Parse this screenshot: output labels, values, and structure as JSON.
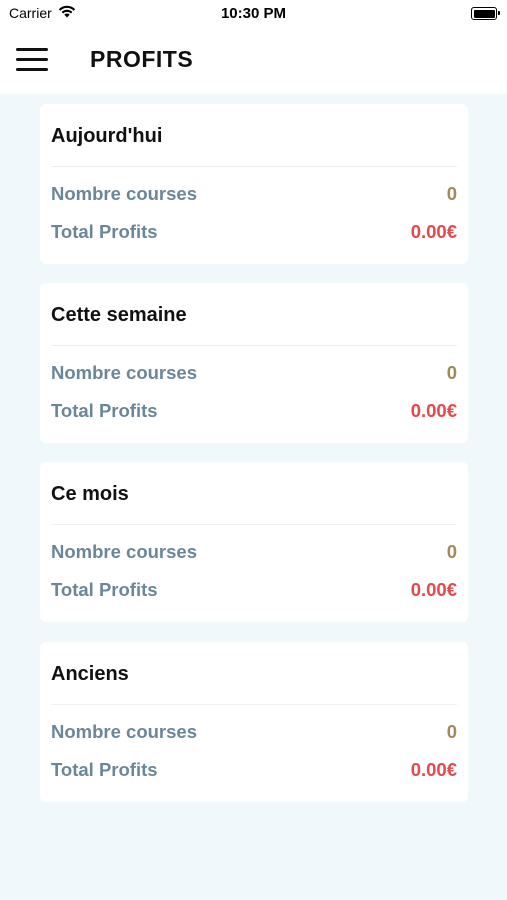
{
  "status_bar": {
    "carrier": "Carrier",
    "time": "10:30 PM",
    "icons": [
      "wifi-icon",
      "battery-icon"
    ]
  },
  "header": {
    "title": "PROFITS",
    "menu_icon": "hamburger-menu-icon"
  },
  "cards": [
    {
      "title": "Aujourd'hui",
      "courses_label": "Nombre courses",
      "courses_value": "0",
      "profits_label": "Total Profits",
      "profits_value": "0.00€"
    },
    {
      "title": "Cette semaine",
      "courses_label": "Nombre courses",
      "courses_value": "0",
      "profits_label": "Total Profits",
      "profits_value": "0.00€"
    },
    {
      "title": "Ce mois",
      "courses_label": "Nombre courses",
      "courses_value": "0",
      "profits_label": "Total Profits",
      "profits_value": "0.00€"
    },
    {
      "title": "Anciens",
      "courses_label": "Nombre courses",
      "courses_value": "0",
      "profits_label": "Total Profits",
      "profits_value": "0.00€"
    }
  ],
  "colors": {
    "background": "#f1f8fb",
    "label": "#6a8799",
    "count": "#a08a5a",
    "profit": "#e5484d"
  }
}
